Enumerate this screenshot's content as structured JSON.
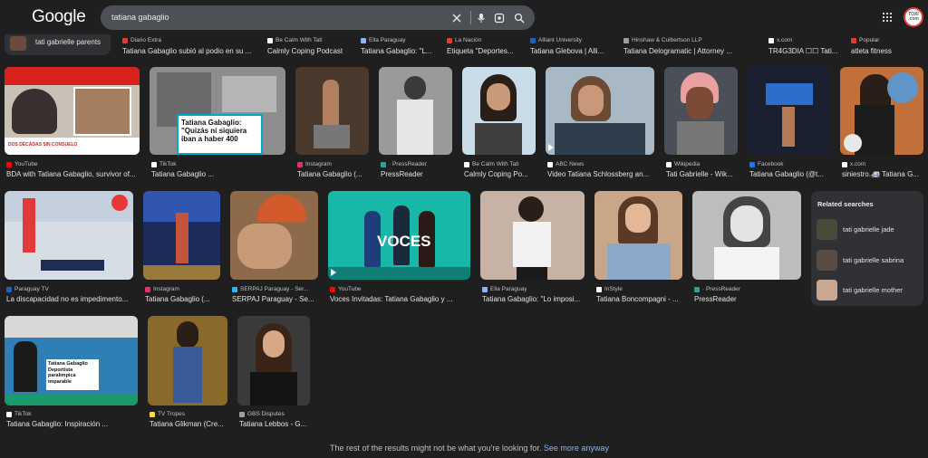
{
  "header": {
    "logo": "Google",
    "search_query": "tatiana gabaglio",
    "avatar_text": "TOXI .com"
  },
  "top_row": {
    "chip_label": "tati gabrielle parents",
    "items": [
      {
        "source": "Diario Extra",
        "title": "Tatiana Gabaglio subió al podio en su ...",
        "color": "#e53935"
      },
      {
        "source": "Be Calm With Tati",
        "title": "Calmly Coping Podcast",
        "color": "#ffffff"
      },
      {
        "source": "Ella Paraguay",
        "title": "Tatiana Gabaglio: \"L...",
        "color": "#8ab4f8"
      },
      {
        "source": "La Nación",
        "title": "Etiqueta \"Deportes...",
        "color": "#e53935"
      },
      {
        "source": "Alliant University",
        "title": "Tatiana Glebova | Alli...",
        "color": "#1565c0"
      },
      {
        "source": "Hinshaw & Culbertson LLP",
        "title": "Tatiana Delogramatic | Attorney ...",
        "color": "#9e9e9e"
      },
      {
        "source": "x.com",
        "title": "TR4G3DIA ☐☐ Tati...",
        "color": "#ffffff"
      },
      {
        "source": "Popular",
        "title": "atleta fitness",
        "color": "#e53935"
      }
    ]
  },
  "row1": [
    {
      "source": "YouTube",
      "title": "BDA with Tatiana Gabaglio, survivor of...",
      "color": "#ff0000"
    },
    {
      "source": "TikTok",
      "title": "Tatiana Gabaglio ...",
      "color": "#ffffff"
    },
    {
      "source": "Instagram",
      "title": "Tatiana Gabaglio (...",
      "color": "#e1306c"
    },
    {
      "source": "· PressReader",
      "title": "PressReader",
      "color": "#26a69a"
    },
    {
      "source": "Be Calm With Tati",
      "title": "Calmly Coping Po...",
      "color": "#ffffff"
    },
    {
      "source": "ABC News",
      "title": "Video Tatiana Schlossberg an...",
      "color": "#ffffff"
    },
    {
      "source": "Wikipedia",
      "title": "Tati Gabrielle - Wik...",
      "color": "#ffffff"
    },
    {
      "source": "Facebook",
      "title": "Tatiana Gabaglio (@t...",
      "color": "#1877f2"
    },
    {
      "source": "x.com",
      "title": "siniestro.🚑 Tatiana G...",
      "color": "#ffffff"
    }
  ],
  "row1_overlay": "Tatiana Gabaglio: \"Quizás ni siquiera iban a haber 400",
  "row1_caption": "DOS DÉCADAS SIN CONSUELO",
  "row2": [
    {
      "source": "Paraguay TV",
      "title": "La discapacidad no es impedimento...",
      "color": "#1565c0"
    },
    {
      "source": "Instagram",
      "title": "Tatiana Gabaglio (...",
      "color": "#e1306c"
    },
    {
      "source": "SERPAJ Paraguay - Ser...",
      "title": "SERPAJ Paraguay - Se...",
      "color": "#29b6f6"
    },
    {
      "source": "YouTube",
      "title": "Voces Invitadas: Tatiana Gabaglio y ...",
      "color": "#ff0000"
    },
    {
      "source": "Ella Paraguay",
      "title": "Tatiana Gabaglio: \"Lo imposi...",
      "color": "#8ab4f8"
    },
    {
      "source": "InStyle",
      "title": "Tatiana Boncompagni - ...",
      "color": "#ffffff"
    },
    {
      "source": "· PressReader",
      "title": "PressReader",
      "color": "#26a69a"
    }
  ],
  "voces_text": "VOCES",
  "row3": [
    {
      "source": "TikTok",
      "title": "Tatiana Gabaglio: Inspiración ...",
      "color": "#ffffff"
    },
    {
      "source": "TV Tropes",
      "title": "Tatiana Glikman (Cre...",
      "color": "#fdd835"
    },
    {
      "source": "GBS Disputes",
      "title": "Tatiana Lebbos - G...",
      "color": "#9e9e9e"
    }
  ],
  "row3_overlay": "Tatiana Gabaglio Deportista paralímpica imparable",
  "related": {
    "header": "Related searches",
    "items": [
      "tati gabrielle jade",
      "tati gabrielle sabrina",
      "tati gabrielle mother"
    ]
  },
  "footer": {
    "note": "The rest of the results might not be what you're looking for.",
    "link": "See more anyway"
  }
}
